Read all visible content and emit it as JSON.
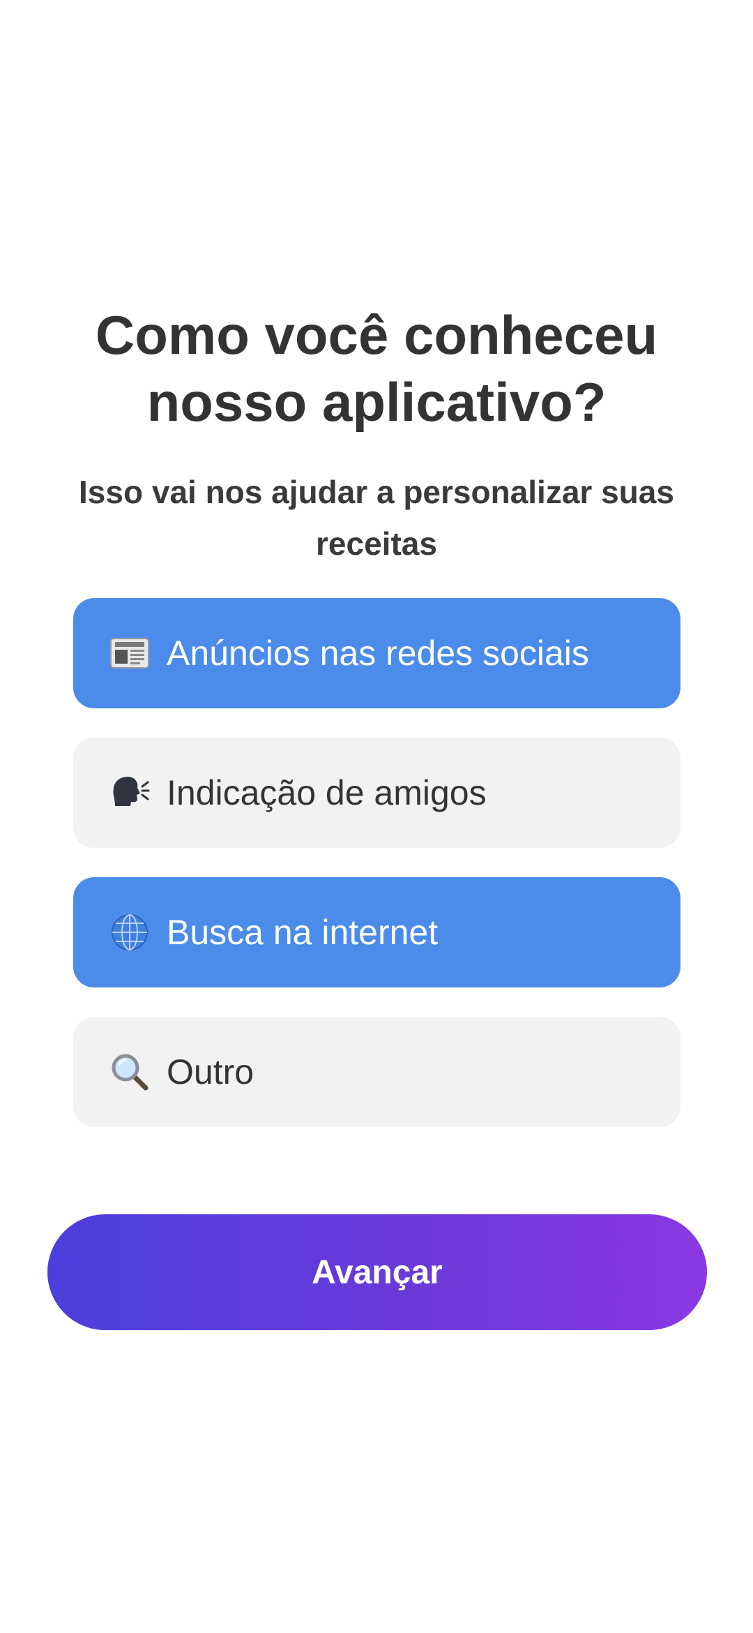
{
  "header": {
    "title_line1": "Como você conheceu",
    "title_line2": "nosso aplicativo?",
    "subtitle_line1": "Isso vai nos ajudar a personalizar suas",
    "subtitle_line2": "receitas"
  },
  "options": [
    {
      "icon": "newspaper-icon",
      "label": "Anúncios nas redes sociais",
      "selected": true
    },
    {
      "icon": "speaking-head-icon",
      "label": "Indicação de amigos",
      "selected": false
    },
    {
      "icon": "globe-icon",
      "label": "Busca na internet",
      "selected": true
    },
    {
      "icon": "magnifier-icon",
      "label": "Outro",
      "selected": false
    }
  ],
  "footer": {
    "next_label": "Avançar"
  },
  "colors": {
    "selected_bg": "#4b8cea",
    "unselected_bg": "#f2f2f2",
    "cta_gradient_start": "#4a3fdc",
    "cta_gradient_end": "#8a39e2"
  }
}
